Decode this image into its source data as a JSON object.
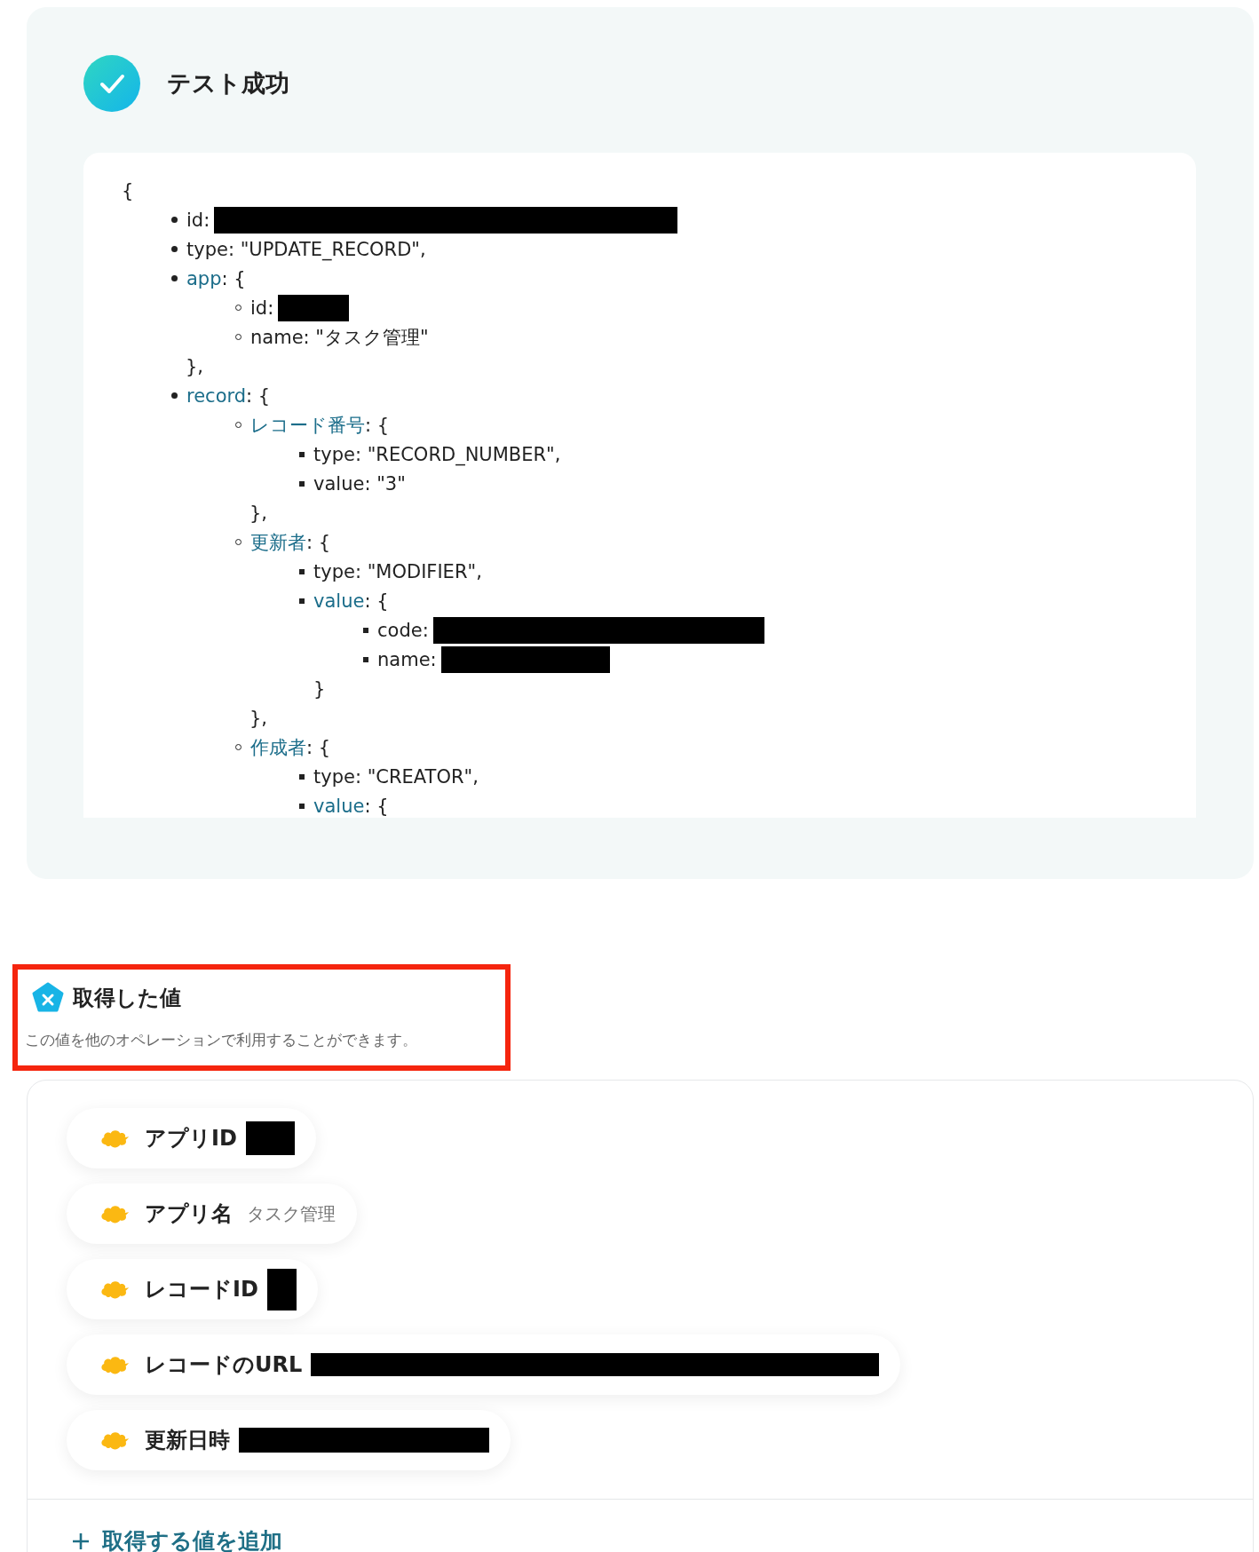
{
  "result": {
    "success": true,
    "title": "テスト成功",
    "code": {
      "open": "{",
      "items": [
        {
          "key": "id",
          "link": false,
          "text": ":",
          "redacted": true
        },
        {
          "key": "type",
          "link": false,
          "text": ": \"UPDATE_RECORD\","
        },
        {
          "key": "app",
          "link": true,
          "text": ": {",
          "close": "},",
          "children": [
            {
              "key": "id",
              "link": false,
              "text": ":",
              "redacted": true
            },
            {
              "key": "name",
              "link": false,
              "text": ": \"タスク管理\""
            }
          ]
        },
        {
          "key": "record",
          "link": true,
          "text": ": {",
          "children": [
            {
              "key": "レコード番号",
              "link": true,
              "text": ": {",
              "close": "},",
              "children": [
                {
                  "key": "type",
                  "link": false,
                  "text": ": \"RECORD_NUMBER\","
                },
                {
                  "key": "value",
                  "link": false,
                  "text": ": \"3\""
                }
              ]
            },
            {
              "key": "更新者",
              "link": true,
              "text": ": {",
              "close": "},",
              "children": [
                {
                  "key": "type",
                  "link": false,
                  "text": ": \"MODIFIER\","
                },
                {
                  "key": "value",
                  "link": true,
                  "text": ": {",
                  "close": "}",
                  "children": [
                    {
                      "key": "code",
                      "link": false,
                      "text": ":",
                      "redacted": true
                    },
                    {
                      "key": "name",
                      "link": false,
                      "text": ":",
                      "redacted": true
                    }
                  ]
                }
              ]
            },
            {
              "key": "作成者",
              "link": true,
              "text": ": {",
              "children": [
                {
                  "key": "type",
                  "link": false,
                  "text": ": \"CREATOR\","
                },
                {
                  "key": "value",
                  "link": true,
                  "text": ": {"
                }
              ]
            }
          ]
        }
      ]
    }
  },
  "values": {
    "title": "取得した値",
    "description": "この値を他のオペレーションで利用することができます。",
    "highlighted": true,
    "items": [
      {
        "label": "アプリID",
        "redacted": true
      },
      {
        "label": "アプリ名",
        "value": "タスク管理",
        "redacted": false
      },
      {
        "label": "レコードID",
        "redacted": true
      },
      {
        "label": "レコードのURL",
        "redacted": true
      },
      {
        "label": "更新日時",
        "redacted": true
      }
    ],
    "add_button": "取得する値を追加"
  }
}
